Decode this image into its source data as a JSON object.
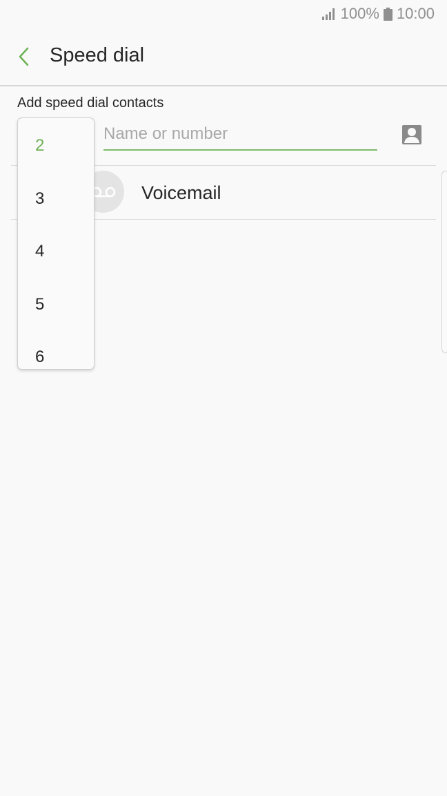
{
  "status_bar": {
    "battery": "100%",
    "time": "10:00",
    "icons": [
      "signal-icon",
      "battery-icon"
    ]
  },
  "header": {
    "title": "Speed dial",
    "back_icon": "chevron-left-icon"
  },
  "speed_dial": {
    "section_label": "Add speed dial contacts",
    "search": {
      "placeholder": "Name or number",
      "value": ""
    },
    "contact_picker_icon": "contact-card-icon",
    "number_options": [
      "2",
      "3",
      "4",
      "5",
      "6"
    ],
    "selected_number": "2"
  },
  "list": {
    "items": [
      {
        "label": "Voicemail",
        "icon": "voicemail-icon"
      }
    ]
  },
  "colors": {
    "accent": "#6cb155",
    "underline": "#7dbd6a",
    "background": "#f9f9f9",
    "text": "#262626"
  }
}
